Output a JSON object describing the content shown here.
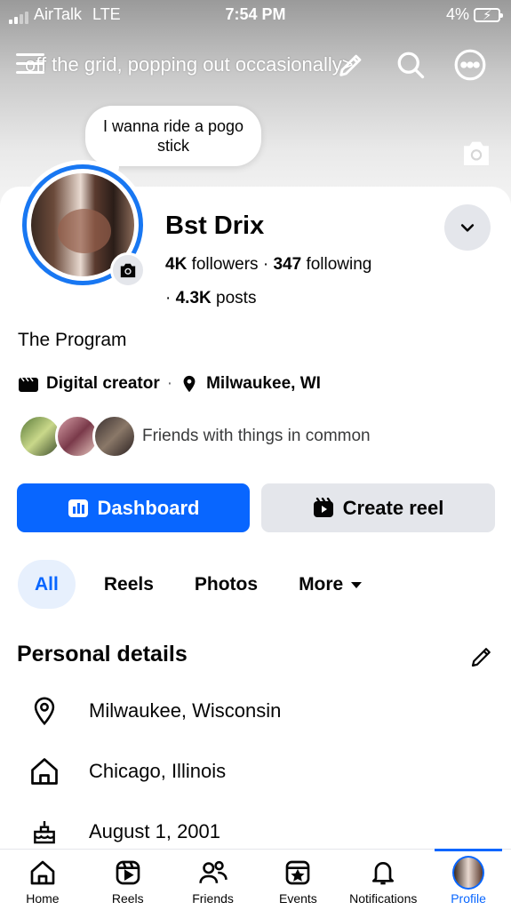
{
  "status_bar": {
    "carrier": "AirTalk",
    "network": "LTE",
    "time": "7:54 PM",
    "battery": "4%"
  },
  "header": {
    "ticker_text": "off the grid, popping out occasionally>"
  },
  "note_bubble": {
    "text": "I wanna ride a pogo stick"
  },
  "profile": {
    "name": "Bst Drix",
    "followers_count": "4K",
    "followers_label": "followers",
    "following_count": "347",
    "following_label": "following",
    "posts_count": "4.3K",
    "posts_label": "posts",
    "bio": "The Program",
    "category": "Digital creator",
    "location": "Milwaukee, WI",
    "friends_text": "Friends with things in common"
  },
  "buttons": {
    "dashboard": "Dashboard",
    "create_reel": "Create reel"
  },
  "tabs": [
    {
      "label": "All",
      "active": true
    },
    {
      "label": "Reels"
    },
    {
      "label": "Photos"
    },
    {
      "label": "More"
    }
  ],
  "personal_details": {
    "title": "Personal details",
    "items": [
      {
        "icon": "location-pin-icon",
        "text": "Milwaukee, Wisconsin"
      },
      {
        "icon": "home-icon",
        "text": "Chicago, Illinois"
      },
      {
        "icon": "birthday-cake-icon",
        "text": "August 1, 2001"
      }
    ]
  },
  "bottom_nav": [
    {
      "label": "Home",
      "icon": "home-icon"
    },
    {
      "label": "Reels",
      "icon": "reels-icon"
    },
    {
      "label": "Friends",
      "icon": "friends-icon"
    },
    {
      "label": "Events",
      "icon": "events-icon"
    },
    {
      "label": "Notifications",
      "icon": "bell-icon"
    },
    {
      "label": "Profile",
      "icon": "profile-avatar",
      "active": true
    }
  ],
  "colors": {
    "accent": "#0866ff",
    "avatar_ring": "#1877f2",
    "button_secondary": "#e4e6eb",
    "tab_active_bg": "#e7f0fd"
  }
}
